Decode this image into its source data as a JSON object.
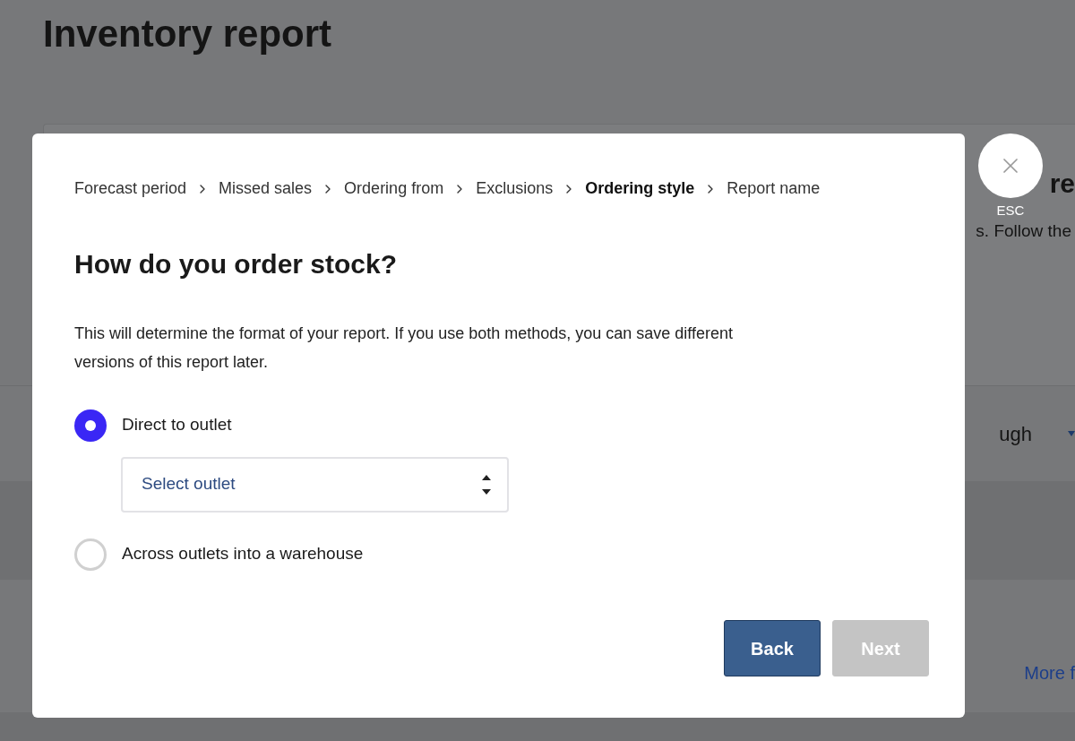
{
  "page_title": "Inventory report",
  "background": {
    "card_heading": "re",
    "card_text": "s. Follow the",
    "dropdown_value": "ugh",
    "link": "More f"
  },
  "dialog": {
    "breadcrumb": [
      {
        "label": "Forecast period",
        "current": false
      },
      {
        "label": "Missed sales",
        "current": false
      },
      {
        "label": "Ordering from",
        "current": false
      },
      {
        "label": "Exclusions",
        "current": false
      },
      {
        "label": "Ordering style",
        "current": true
      },
      {
        "label": "Report name",
        "current": false
      }
    ],
    "heading": "How do you order stock?",
    "description": "This will determine the format of your report. If you use both methods, you can save different versions of this report later.",
    "options": [
      {
        "label": "Direct to outlet",
        "selected": true,
        "select": {
          "placeholder": "Select outlet"
        }
      },
      {
        "label": "Across outlets into a warehouse",
        "selected": false
      }
    ],
    "buttons": [
      {
        "label": "Back",
        "kind": "secondary",
        "disabled": false
      },
      {
        "label": "Next",
        "kind": "primary",
        "disabled": true
      }
    ],
    "close": {
      "hint": "ESC"
    }
  }
}
